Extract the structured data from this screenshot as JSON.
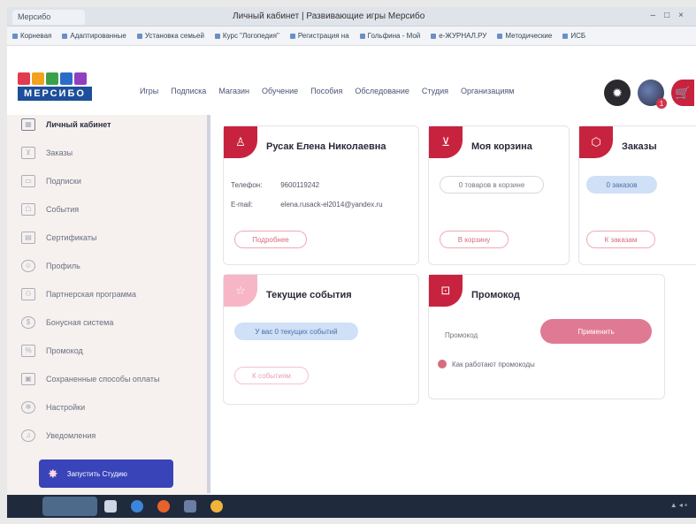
{
  "browser": {
    "tab_label": "Мерсибо",
    "window_title": "Личный кабинет | Развивающие игры Мерсибо",
    "window_controls": [
      "–",
      "□",
      "×"
    ],
    "bookmarks": [
      "Корневая",
      "Адаптированные",
      "Установка семьей",
      "Курс \"Логопедия\"",
      "Регистрация на",
      "Гольфина - Мой",
      "e-ЖУРНАЛ.РУ",
      "Методические",
      "ИСБ"
    ]
  },
  "site_header": {
    "logo_text": "МЕРСИБО",
    "logo_colors": [
      "#e23b4f",
      "#f2a21e",
      "#3aa14a",
      "#2b6cc9",
      "#8f3fbf"
    ],
    "nav": [
      "Игры",
      "Подписка",
      "Магазин",
      "Обучение",
      "Пособия",
      "Обследование",
      "Студия",
      "Организациям"
    ],
    "avatar_badge": "1"
  },
  "sidebar": {
    "items": [
      {
        "label": "Личный кабинет",
        "icon": "grid-icon",
        "active": true
      },
      {
        "label": "Заказы",
        "icon": "cart-icon",
        "active": false
      },
      {
        "label": "Подписки",
        "icon": "card-icon",
        "active": false
      },
      {
        "label": "События",
        "icon": "ticket-icon",
        "active": false
      },
      {
        "label": "Сертификаты",
        "icon": "certificate-icon",
        "active": false
      },
      {
        "label": "Профиль",
        "icon": "user-icon",
        "active": false
      },
      {
        "label": "Партнерская программа",
        "icon": "partners-icon",
        "active": false
      },
      {
        "label": "Бонусная система",
        "icon": "bonus-icon",
        "active": false
      },
      {
        "label": "Промокод",
        "icon": "promo-icon",
        "active": false
      },
      {
        "label": "Сохраненные способы оплаты",
        "icon": "wallet-icon",
        "active": false
      },
      {
        "label": "Настройки",
        "icon": "gear-icon",
        "active": false
      },
      {
        "label": "Уведомления",
        "icon": "bell-icon",
        "active": false
      }
    ],
    "studio_button": "Запустить Студию"
  },
  "profile_card": {
    "name": "Русак Елена Николаевна",
    "phone_label": "Телефон:",
    "phone_value": "9600119242",
    "email_label": "E-mail:",
    "email_value": "elena.rusack-el2014@yandex.ru",
    "details_button": "Подробнее"
  },
  "cart_card": {
    "title": "Моя корзина",
    "status": "0 товаров в корзине",
    "button": "В корзину"
  },
  "orders_card": {
    "title": "Заказы",
    "status": "0 заказов",
    "button": "К заказам"
  },
  "events_card": {
    "title": "Текущие события",
    "status": "У вас 0 текущих событий",
    "button": "К событиям"
  },
  "promo_card": {
    "title": "Промокод",
    "input_placeholder": "Промокод",
    "apply_button": "Применить",
    "help_link": "Как работают промокоды"
  },
  "colors": {
    "accent_red": "#c8233e",
    "accent_pink": "#e07a94",
    "studio_blue": "#3844b8"
  }
}
